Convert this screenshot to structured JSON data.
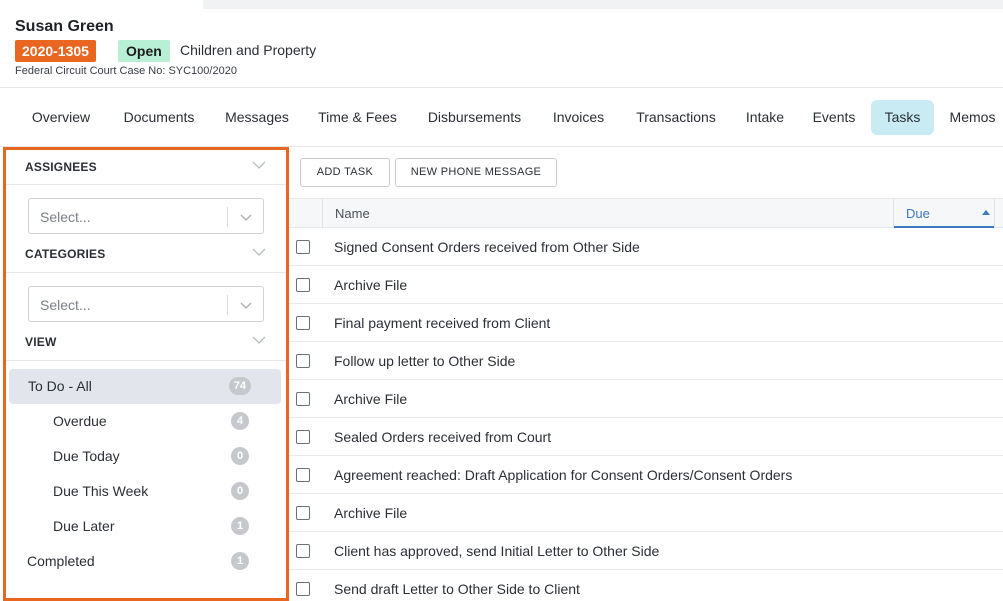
{
  "header": {
    "client_name": "Susan Green",
    "case_number": "2020-1305",
    "status": "Open",
    "case_type": "Children and Property",
    "court_case": "Federal Circuit Court Case No: SYC100/2020"
  },
  "tabs": [
    {
      "label": "Overview",
      "active": false
    },
    {
      "label": "Documents",
      "active": false
    },
    {
      "label": "Messages",
      "active": false
    },
    {
      "label": "Time & Fees",
      "active": false
    },
    {
      "label": "Disbursements",
      "active": false
    },
    {
      "label": "Invoices",
      "active": false
    },
    {
      "label": "Transactions",
      "active": false
    },
    {
      "label": "Intake",
      "active": false
    },
    {
      "label": "Events",
      "active": false
    },
    {
      "label": "Tasks",
      "active": true
    },
    {
      "label": "Memos",
      "active": false
    }
  ],
  "filters": {
    "assignees": {
      "title": "ASSIGNEES",
      "placeholder": "Select..."
    },
    "categories": {
      "title": "CATEGORIES",
      "placeholder": "Select..."
    },
    "view": {
      "title": "VIEW",
      "items": [
        {
          "label": "To Do - All",
          "count": "74",
          "active": true
        },
        {
          "label": "Overdue",
          "count": "4",
          "active": false
        },
        {
          "label": "Due Today",
          "count": "0",
          "active": false
        },
        {
          "label": "Due This Week",
          "count": "0",
          "active": false
        },
        {
          "label": "Due Later",
          "count": "1",
          "active": false
        },
        {
          "label": "Completed",
          "count": "1",
          "active": false
        }
      ]
    }
  },
  "toolbar": {
    "add_task": "ADD TASK",
    "new_phone_message": "NEW PHONE MESSAGE"
  },
  "table": {
    "columns": {
      "name": "Name",
      "due": "Due"
    },
    "sort": "Due ascending",
    "rows": [
      "Signed Consent Orders received from Other Side",
      "Archive File",
      "Final payment received from Client",
      "Follow up letter to Other Side",
      "Archive File",
      "Sealed Orders received from Court",
      "Agreement reached: Draft Application for Consent Orders/Consent Orders",
      "Archive File",
      "Client has approved, send Initial Letter to Other Side",
      "Send draft Letter to Other Side to Client"
    ]
  },
  "colors": {
    "accent_orange": "#e8661f",
    "status_green": "#b8f0d6",
    "active_tab": "#c9ecf4",
    "sort_blue": "#3c78c4"
  }
}
